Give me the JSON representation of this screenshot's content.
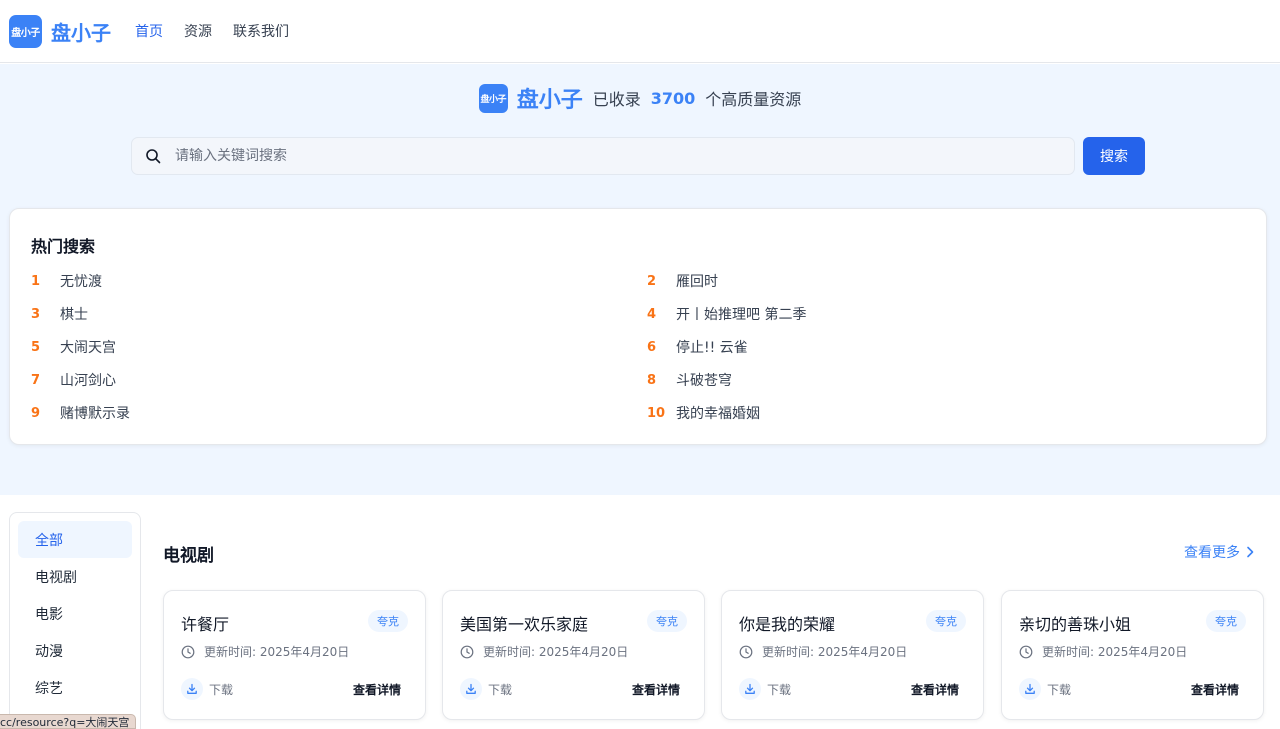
{
  "header": {
    "logo_text": "盘小子",
    "brand": "盘小子",
    "nav": [
      {
        "label": "首页",
        "active": true
      },
      {
        "label": "资源",
        "active": false
      },
      {
        "label": "联系我们",
        "active": false
      }
    ]
  },
  "hero": {
    "logo_text": "盘小子",
    "brand": "盘小子",
    "prefix": "已收录",
    "count": "3700",
    "suffix": "个高质量资源",
    "search_placeholder": "请输入关键词搜索",
    "search_button": "搜索"
  },
  "hot": {
    "title": "热门搜索",
    "items": [
      {
        "rank": "1",
        "name": "无忧渡"
      },
      {
        "rank": "2",
        "name": "雁回时"
      },
      {
        "rank": "3",
        "name": "棋士"
      },
      {
        "rank": "4",
        "name": "开丨始推理吧 第二季"
      },
      {
        "rank": "5",
        "name": "大闹天宫"
      },
      {
        "rank": "6",
        "name": "停止!! 云雀"
      },
      {
        "rank": "7",
        "name": "山河剑心"
      },
      {
        "rank": "8",
        "name": "斗破苍穹"
      },
      {
        "rank": "9",
        "name": "赌博默示录"
      },
      {
        "rank": "10",
        "name": "我的幸福婚姻"
      }
    ]
  },
  "sidebar": {
    "items": [
      {
        "label": "全部",
        "active": true
      },
      {
        "label": "电视剧",
        "active": false
      },
      {
        "label": "电影",
        "active": false
      },
      {
        "label": "动漫",
        "active": false
      },
      {
        "label": "综艺",
        "active": false
      }
    ]
  },
  "section": {
    "title": "电视剧",
    "more": "查看更多",
    "cards": [
      {
        "title": "许餐厅",
        "tag": "夸克",
        "time": "更新时间: 2025年4月20日",
        "download": "下载",
        "detail": "查看详情"
      },
      {
        "title": "美国第一欢乐家庭",
        "tag": "夸克",
        "time": "更新时间: 2025年4月20日",
        "download": "下载",
        "detail": "查看详情"
      },
      {
        "title": "你是我的荣耀",
        "tag": "夸克",
        "time": "更新时间: 2025年4月20日",
        "download": "下载",
        "detail": "查看详情"
      },
      {
        "title": "亲切的善珠小姐",
        "tag": "夸克",
        "time": "更新时间: 2025年4月20日",
        "download": "下载",
        "detail": "查看详情"
      }
    ]
  },
  "status_bar": {
    "url": "cc/resource?q=大闹天宫"
  },
  "colors": {
    "accent": "#2563eb",
    "brand": "#3b82f6",
    "rank": "#f97316",
    "hero_bg": "#eff6ff"
  }
}
